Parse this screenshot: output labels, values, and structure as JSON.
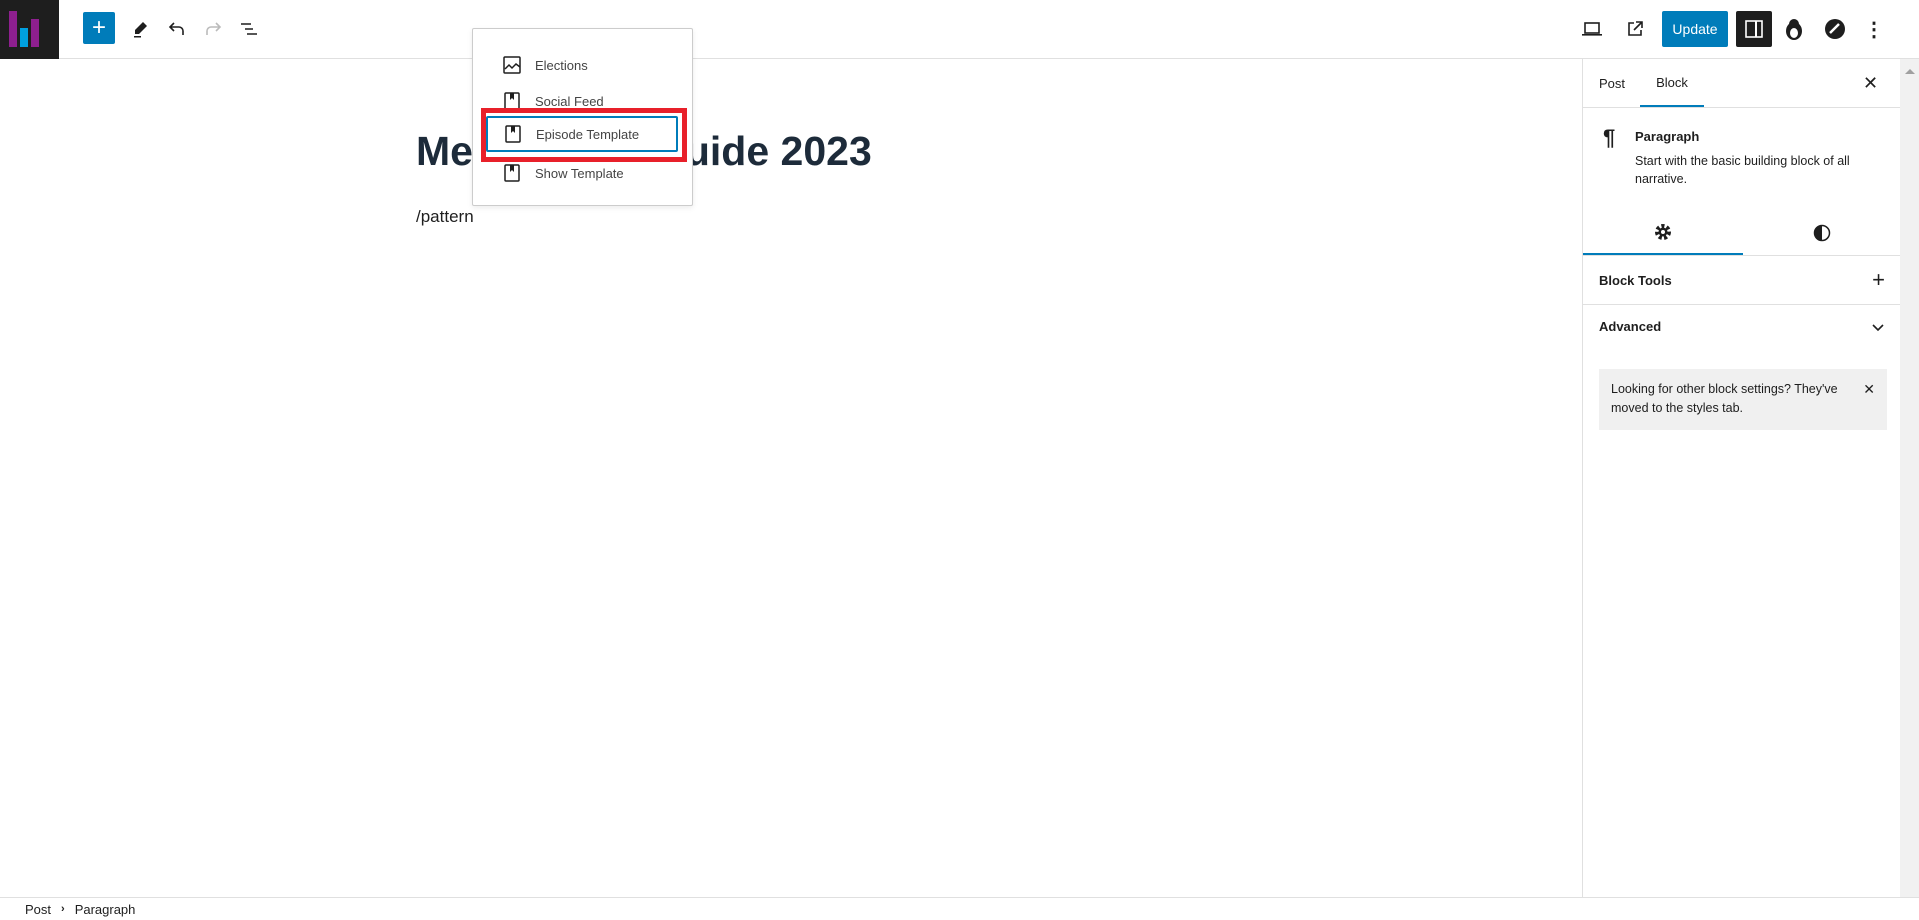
{
  "header": {
    "update_label": "Update"
  },
  "editor": {
    "title_visible_start": "Me",
    "title_visible_end": "Guide 2023",
    "paragraph": "/pattern"
  },
  "pattern_menu": {
    "items": [
      {
        "label": "Elections",
        "icon": "chart-line-icon"
      },
      {
        "label": "Social Feed",
        "icon": "bookmark-icon"
      },
      {
        "label": "Episode Template",
        "icon": "bookmark-icon",
        "selected": true
      },
      {
        "label": "Show Template",
        "icon": "bookmark-icon"
      }
    ]
  },
  "sidebar": {
    "tabs": [
      {
        "label": "Post"
      },
      {
        "label": "Block",
        "active": true
      }
    ],
    "block": {
      "name": "Paragraph",
      "description": "Start with the basic building block of all narrative."
    },
    "panels": [
      {
        "label": "Block Tools"
      },
      {
        "label": "Advanced"
      }
    ],
    "notice": "Looking for other block settings? They've moved to the styles tab."
  },
  "breadcrumb": [
    "Post",
    "Paragraph"
  ],
  "colors": {
    "accent": "#007cba",
    "highlight": "#e8202a",
    "logo_purple": "#8e1f8f",
    "logo_blue": "#00a0e0"
  }
}
